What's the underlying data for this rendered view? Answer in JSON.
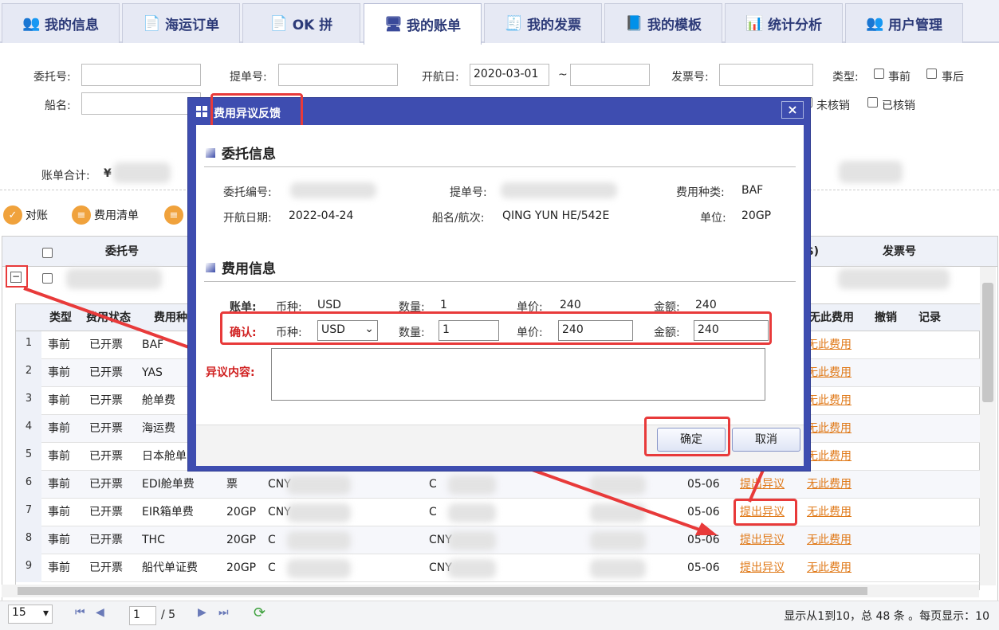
{
  "tabs": [
    {
      "label": "我的信息",
      "icon": "users-icon"
    },
    {
      "label": "海运订单",
      "icon": "document-icon"
    },
    {
      "label": "OK 拼",
      "icon": "document-icon"
    },
    {
      "label": "我的账单",
      "icon": "monitor-icon"
    },
    {
      "label": "我的发票",
      "icon": "receipt-icon"
    },
    {
      "label": "我的模板",
      "icon": "file-icon"
    },
    {
      "label": "统计分析",
      "icon": "bar-chart-icon"
    },
    {
      "label": "用户管理",
      "icon": "users-icon"
    }
  ],
  "filter": {
    "weituo": "委托号:",
    "tidan": "提单号:",
    "kaihang": "开航日:",
    "kaihang_from": "2020-03-01",
    "tilde": "~",
    "fapiao": "发票号:",
    "leixing": "类型:",
    "shiqian": "事前",
    "shihou": "事后",
    "chuanming": "船名:",
    "weihexiao": "未核销",
    "yihexiao": "已核销",
    "heji": "账单合计:",
    "yen": "¥"
  },
  "toolbar": {
    "duizhang": "对账",
    "feiyong": "费用清单"
  },
  "grid": {
    "h_weituo": "委托号",
    "h_fapiao": "发票号",
    "h_usd": "$)"
  },
  "sub": {
    "headers": {
      "leixing": "类型",
      "zhuangtai": "费用状态",
      "zhonglei": "费用种",
      "wuci": "无此费用",
      "chexiao": "撤销",
      "jilu": "记录"
    },
    "rows": [
      {
        "n": "1",
        "t": "事前",
        "s": "已开票",
        "f": "BAF",
        "u": "",
        "c1": "",
        "c2": "",
        "d": "",
        "a1": "",
        "a2": "无此费用"
      },
      {
        "n": "2",
        "t": "事前",
        "s": "已开票",
        "f": "YAS",
        "u": "",
        "c1": "",
        "c2": "",
        "d": "",
        "a1": "",
        "a2": "无此费用"
      },
      {
        "n": "3",
        "t": "事前",
        "s": "已开票",
        "f": "舱单费",
        "u": "",
        "c1": "",
        "c2": "",
        "d": "",
        "a1": "",
        "a2": "无此费用"
      },
      {
        "n": "4",
        "t": "事前",
        "s": "已开票",
        "f": "海运费",
        "u": "",
        "c1": "",
        "c2": "",
        "d": "",
        "a1": "",
        "a2": "无此费用"
      },
      {
        "n": "5",
        "t": "事前",
        "s": "已开票",
        "f": "日本舱单",
        "u": "",
        "c1": "",
        "c2": "",
        "d": "",
        "a1": "",
        "a2": "无此费用"
      },
      {
        "n": "6",
        "t": "事前",
        "s": "已开票",
        "f": "EDI舱单费",
        "u": "票",
        "c1": "CNY",
        "c2": "C",
        "d": "05-06",
        "a1": "提出异议",
        "a2": "无此费用"
      },
      {
        "n": "7",
        "t": "事前",
        "s": "已开票",
        "f": "EIR箱单费",
        "u": "20GP",
        "c1": "CNY",
        "c2": "C",
        "d": "05-06",
        "a1": "提出异议",
        "a2": "无此费用"
      },
      {
        "n": "8",
        "t": "事前",
        "s": "已开票",
        "f": "THC",
        "u": "20GP",
        "c1": "C",
        "c2": "CNY",
        "d": "05-06",
        "a1": "提出异议",
        "a2": "无此费用"
      },
      {
        "n": "9",
        "t": "事前",
        "s": "已开票",
        "f": "船代单证费",
        "u": "20GP",
        "c1": "C",
        "c2": "CNY",
        "d": "05-06",
        "a1": "提出异议",
        "a2": "无此费用"
      }
    ]
  },
  "pager": {
    "size": "15",
    "page": "1",
    "total": "/ 5",
    "info": "显示从1到10，总 48 条 。每页显示：10"
  },
  "modal": {
    "title": "费用异议反馈",
    "close": "×",
    "sec1": "委托信息",
    "sec2": "费用信息",
    "l_weituo": "委托编号:",
    "l_tidan": "提单号:",
    "l_zhonglei": "费用种类:",
    "v_zhonglei": "BAF",
    "l_kaihang": "开航日期:",
    "v_kaihang": "2022-04-24",
    "l_chuan": "船名/航次:",
    "v_chuan": "QING YUN HE/542E",
    "l_danwei": "单位:",
    "v_danwei": "20GP",
    "zd": "账单:",
    "bz": "币种:",
    "bz_v": "USD",
    "sl": "数量:",
    "sl_v": "1",
    "dj": "单价:",
    "dj_v": "240",
    "je": "金额:",
    "je_v": "240",
    "qr": "确认:",
    "qr_bz": "USD",
    "qr_sl": "1",
    "qr_dj": "240",
    "qr_je": "240",
    "yiyi": "异议内容:",
    "ok": "确定",
    "cancel": "取消"
  },
  "colors": {
    "accent": "#3e4db0",
    "highlight": "#e83a3a",
    "link": "#e07a1a"
  }
}
